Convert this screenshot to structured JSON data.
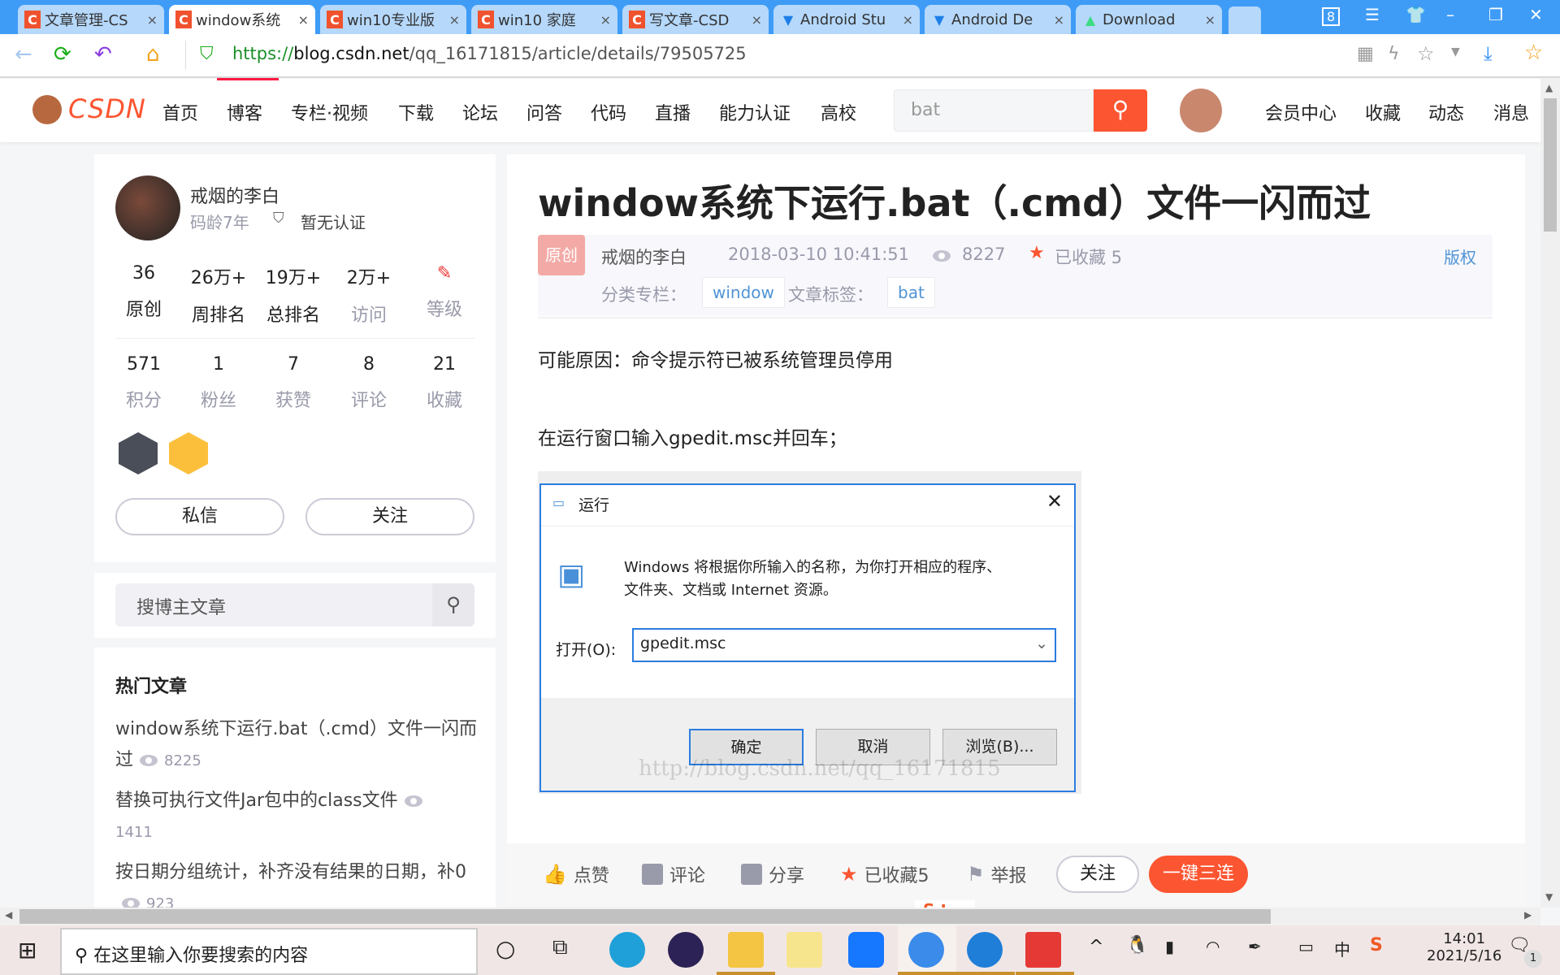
{
  "browser": {
    "tabs": [
      {
        "label": "文章管理-CS",
        "icon": "csdn-icon"
      },
      {
        "label": "window系统",
        "icon": "csdn-icon",
        "active": true
      },
      {
        "label": "win10专业版",
        "icon": "csdn-icon"
      },
      {
        "label": "win10 家庭",
        "icon": "csdn-icon"
      },
      {
        "label": "写文章-CSD",
        "icon": "csdn-icon"
      },
      {
        "label": "Android Stu",
        "icon": "funnel-icon"
      },
      {
        "label": "Android De",
        "icon": "funnel-icon"
      },
      {
        "label": "Download",
        "icon": "android-icon"
      }
    ],
    "tab_close": "×",
    "window_badge": "8",
    "url_scheme": "https://",
    "url_domain": "blog.csdn.net",
    "url_path": "/qq_16171815/article/details/79505725"
  },
  "header": {
    "logo": "CSDN",
    "nav": [
      "首页",
      "博客",
      "专栏·视频",
      "下载",
      "论坛",
      "问答",
      "代码",
      "直播",
      "能力认证",
      "高校"
    ],
    "search_value": "bat",
    "right_links": [
      "会员中心",
      "收藏",
      "动态",
      "消息"
    ]
  },
  "profile": {
    "name": "戒烟的李白",
    "code_age": "码龄7年",
    "cert": "暂无认证",
    "stats1": [
      {
        "n": "36",
        "l": "原创"
      },
      {
        "n": "26万+",
        "l": "周排名"
      },
      {
        "n": "19万+",
        "l": "总排名"
      },
      {
        "n": "2万+",
        "l": "访问"
      },
      {
        "n": "",
        "l": "等级"
      }
    ],
    "stats2": [
      {
        "n": "571",
        "l": "积分"
      },
      {
        "n": "1",
        "l": "粉丝"
      },
      {
        "n": "7",
        "l": "获赞"
      },
      {
        "n": "8",
        "l": "评论"
      },
      {
        "n": "21",
        "l": "收藏"
      }
    ],
    "message_btn": "私信",
    "follow_btn": "关注"
  },
  "blog_search": {
    "placeholder": "搜博主文章"
  },
  "hot": {
    "title": "热门文章",
    "items": [
      {
        "title": "window系统下运行.bat（.cmd）文件一闪而过",
        "views": "8225"
      },
      {
        "title": "替换可执行文件Jar包中的class文件",
        "views": "1411"
      },
      {
        "title": "按日期分组统计，补齐没有结果的日期，补0",
        "views": "923"
      }
    ]
  },
  "article": {
    "title": "window系统下运行.bat（.cmd）文件一闪而过",
    "badge": "原创",
    "author": "戒烟的李白",
    "date": "2018-03-10 10:41:51",
    "views": "8227",
    "collected": "已收藏 5",
    "copyright": "版权",
    "category_label": "分类专栏：",
    "category": "window",
    "tags_label": "文章标签：",
    "tag": "bat",
    "p1": "可能原因：命令提示符已被系统管理员停用",
    "p2": "在运行窗口输入gpedit.msc并回车；"
  },
  "run_dialog": {
    "title": "运行",
    "desc1": "Windows 将根据你所输入的名称，为你打开相应的程序、",
    "desc2": "文件夹、文档或 Internet 资源。",
    "open_label": "打开(O):",
    "value": "gpedit.msc",
    "ok": "确定",
    "cancel": "取消",
    "browse": "浏览(B)...",
    "watermark": "http://blog.csdn.net/qq_16171815"
  },
  "toolbar": {
    "like": "点赞",
    "comment": "评论",
    "share": "分享",
    "collected": "已收藏5",
    "report": "举报",
    "follow": "关注",
    "triple": "一键三连"
  },
  "taskbar": {
    "search_placeholder": "在这里输入你要搜索的内容",
    "ime": "中",
    "time": "14:01",
    "date": "2021/5/16",
    "notif_count": "1"
  },
  "colors": {
    "accent": "#fc5531",
    "tabbar": "#3f9cf6",
    "link": "#5094d5"
  }
}
